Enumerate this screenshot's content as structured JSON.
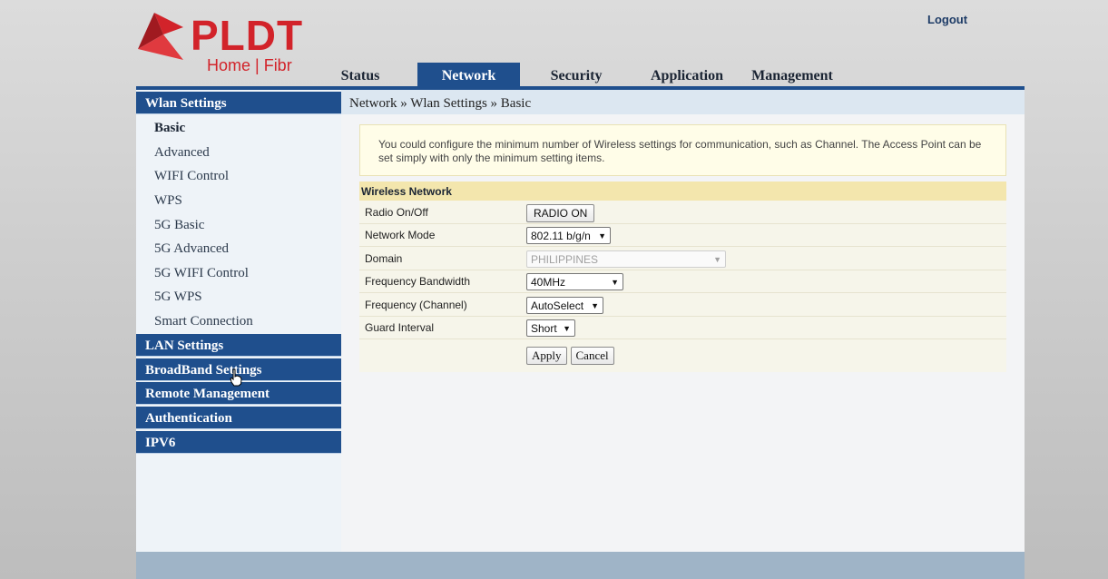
{
  "brand": {
    "name": "PLDT",
    "sub": "Home | Fibr",
    "colors": {
      "brand_red": "#d2232a",
      "nav_blue": "#1f4f8d"
    }
  },
  "header": {
    "logout_label": "Logout"
  },
  "nav": {
    "tabs": [
      {
        "label": "Status"
      },
      {
        "label": "Network",
        "active": true
      },
      {
        "label": "Security"
      },
      {
        "label": "Application"
      },
      {
        "label": "Management"
      }
    ]
  },
  "sidebar": {
    "wlan_heading": "Wlan Settings",
    "items": [
      {
        "label": "Basic",
        "active": true
      },
      {
        "label": "Advanced"
      },
      {
        "label": "WIFI Control"
      },
      {
        "label": "WPS"
      },
      {
        "label": "5G Basic"
      },
      {
        "label": "5G Advanced"
      },
      {
        "label": "5G WIFI Control"
      },
      {
        "label": "5G WPS"
      },
      {
        "label": "Smart Connection"
      }
    ],
    "sections": [
      {
        "label": "LAN Settings"
      },
      {
        "label": "BroadBand Settings"
      },
      {
        "label": "Remote Management"
      },
      {
        "label": "Authentication"
      },
      {
        "label": "IPV6"
      }
    ]
  },
  "main": {
    "breadcrumb": "Network » Wlan Settings » Basic",
    "notice": "You could configure the minimum number of Wireless settings for communication, such as Channel. The Access Point can be set simply with only the minimum setting items.",
    "section_title": "Wireless Network",
    "fields": {
      "radio": {
        "label": "Radio On/Off",
        "value": "RADIO ON"
      },
      "network_mode": {
        "label": "Network Mode",
        "value": "802.11 b/g/n"
      },
      "domain": {
        "label": "Domain",
        "value": "PHILIPPINES"
      },
      "bandwidth": {
        "label": "Frequency Bandwidth",
        "value": "40MHz"
      },
      "channel": {
        "label": "Frequency (Channel)",
        "value": "AutoSelect"
      },
      "guard": {
        "label": "Guard Interval",
        "value": "Short"
      }
    },
    "apply_label": "Apply",
    "cancel_label": "Cancel"
  }
}
